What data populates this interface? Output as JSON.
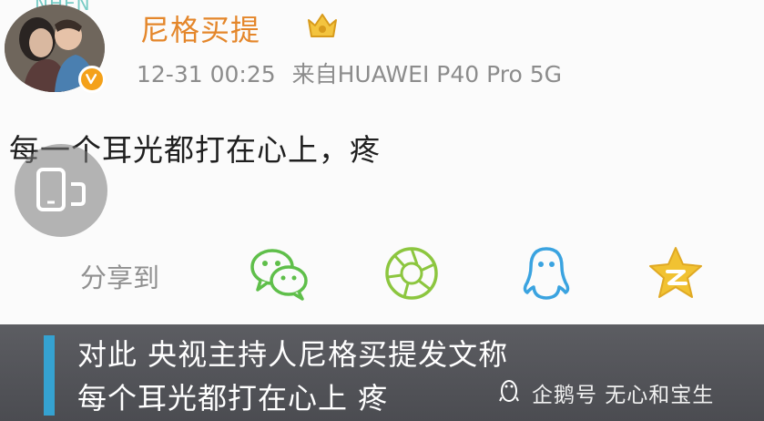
{
  "post": {
    "watermark": "NHEN",
    "username": "尼格买提",
    "timestamp": "12-31 00:25",
    "source": "来自HUAWEI P40 Pro 5G",
    "content": "每一个耳光都打在心上，疼",
    "share_label": "分享到"
  },
  "share": {
    "items": [
      {
        "name": "wechat",
        "icon": "wechat-icon"
      },
      {
        "name": "moments",
        "icon": "moments-icon"
      },
      {
        "name": "qq",
        "icon": "qq-icon"
      },
      {
        "name": "qzone",
        "icon": "qzone-icon"
      }
    ]
  },
  "caption": {
    "line1": "对此 央视主持人尼格买提发文称",
    "line2": "每个耳光都打在心上 疼"
  },
  "attribution": {
    "text": "企鹅号 无心和宝生"
  },
  "colors": {
    "username": "#e4862a",
    "verified_badge": "#f4a11a",
    "share_green": "#5fbf4a",
    "share_blue": "#3aa3e0",
    "share_gold": "#f1c232",
    "caption_bg": "#55565b",
    "caption_accent": "#35a2d1"
  }
}
